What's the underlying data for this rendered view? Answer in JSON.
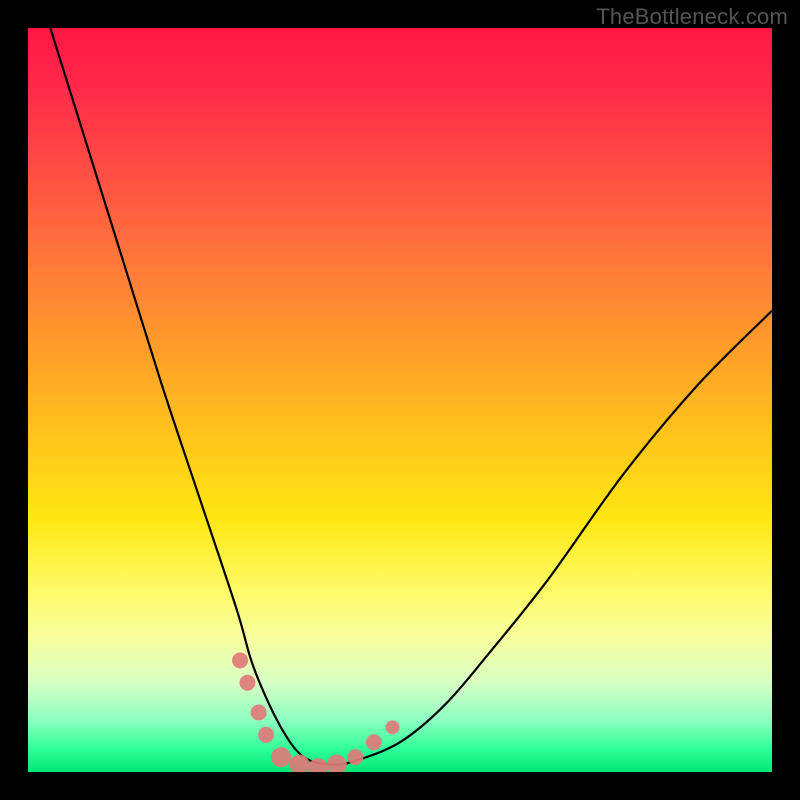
{
  "watermark": "TheBottleneck.com",
  "chart_data": {
    "type": "line",
    "title": "",
    "xlabel": "",
    "ylabel": "",
    "xlim": [
      0,
      100
    ],
    "ylim": [
      0,
      100
    ],
    "series": [
      {
        "name": "bottleneck-curve",
        "x": [
          3,
          8,
          13,
          18,
          23,
          28,
          30,
          32,
          34,
          36,
          38,
          41,
          44,
          50,
          56,
          62,
          70,
          80,
          90,
          100
        ],
        "y": [
          100,
          84,
          68,
          52,
          37,
          22,
          15,
          10,
          6,
          3,
          1.5,
          1,
          1.5,
          4,
          9,
          16,
          26,
          40,
          52,
          62
        ]
      }
    ],
    "markers": [
      {
        "x": 28.5,
        "y": 15,
        "r": 8
      },
      {
        "x": 29.5,
        "y": 12,
        "r": 8
      },
      {
        "x": 31.0,
        "y": 8,
        "r": 8
      },
      {
        "x": 32.0,
        "y": 5,
        "r": 8
      },
      {
        "x": 34.0,
        "y": 2,
        "r": 10
      },
      {
        "x": 36.5,
        "y": 1,
        "r": 10
      },
      {
        "x": 39.0,
        "y": 0.5,
        "r": 10
      },
      {
        "x": 41.5,
        "y": 1,
        "r": 10
      },
      {
        "x": 44.0,
        "y": 2,
        "r": 8
      },
      {
        "x": 46.5,
        "y": 4,
        "r": 8
      },
      {
        "x": 49.0,
        "y": 6,
        "r": 7
      }
    ],
    "marker_color": "#e07a7a"
  }
}
